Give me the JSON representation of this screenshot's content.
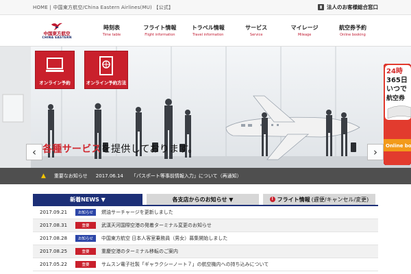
{
  "topbar": {
    "breadcrumb": "HOME | 中国東方航空/China Eastern Airlines(MU) 【公式】",
    "corporate_link": "法人のお客様総合窓口"
  },
  "logo": {
    "cn": "中国東方航空",
    "en": "CHINA EASTERN"
  },
  "nav": [
    {
      "label": "時刻表",
      "sub": "Time table"
    },
    {
      "label": "フライト情報",
      "sub": "Flight information"
    },
    {
      "label": "トラベル情報",
      "sub": "Travel information"
    },
    {
      "label": "サービス",
      "sub": "Service"
    },
    {
      "label": "マイレージ",
      "sub": "Mileage"
    },
    {
      "label": "航空券予約",
      "sub": "Online booking"
    }
  ],
  "quick": [
    {
      "label": "オンライン予約"
    },
    {
      "label": "オンライン予約方法"
    }
  ],
  "hero": {
    "text_red": "各種サービス",
    "text_rest": "を提供しております。"
  },
  "promo": {
    "line1": "24時",
    "line2": "365日",
    "line3": "いつで",
    "line4": "航空券",
    "banner": "Online boo"
  },
  "notice": {
    "label": "重要なお知らせ",
    "date": "2017.06.14",
    "text": "「パスポート等事前情報入力」について（再通知）"
  },
  "tabs": {
    "news": "新着NEWS ▼",
    "branch": "各支店からのお知らせ ▼",
    "flight_strong": "フライト情報",
    "flight_rest": "(遅便/キャンセル/変更)"
  },
  "colors": {
    "brand_red": "#c9202c",
    "brand_navy": "#1c2f77"
  },
  "news": [
    {
      "date": "2017.09.21",
      "badge": "お知らせ",
      "type": "info",
      "title": "燃油サーチャージを更新しました"
    },
    {
      "date": "2017.08.31",
      "badge": "重要",
      "type": "important",
      "title": "武漢天河国際空港の発着ターミナル変更のお知らせ"
    },
    {
      "date": "2017.08.28",
      "badge": "お知らせ",
      "type": "info",
      "title": "中国東方航空 日本人客室乗務員（男女）募集開始しました"
    },
    {
      "date": "2017.08.25",
      "badge": "重要",
      "type": "important",
      "title": "重慶空港のターミナル移転のご案内"
    },
    {
      "date": "2017.05.22",
      "badge": "重要",
      "type": "important",
      "title": "サムスン電子社製「ギャラクシーノート７」の航空機内への持ち込みについて"
    }
  ]
}
